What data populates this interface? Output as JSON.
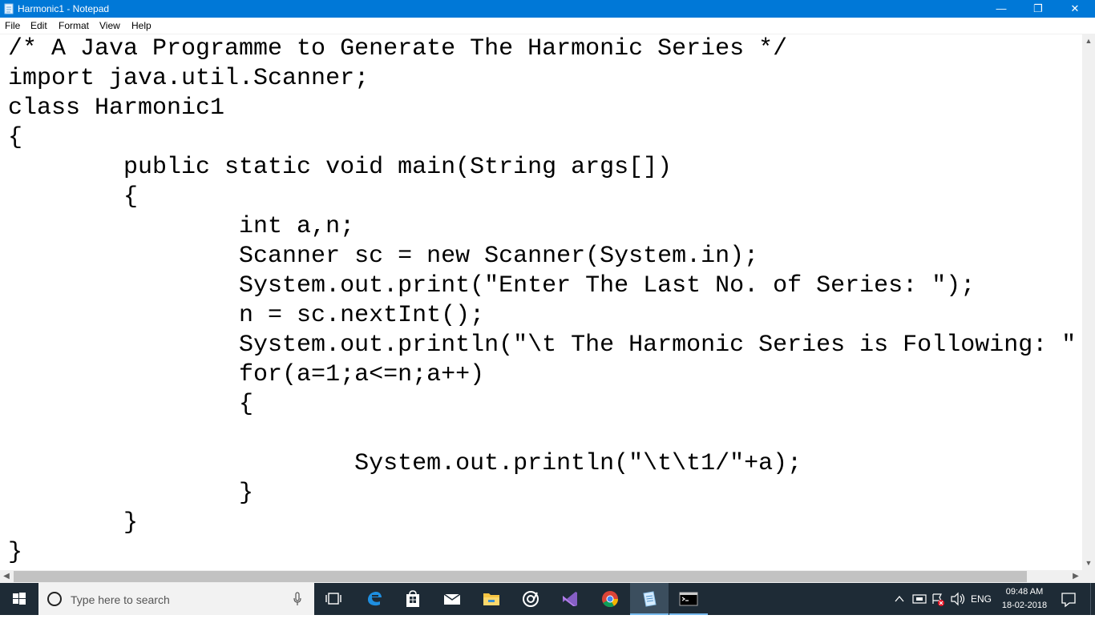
{
  "window": {
    "title": "Harmonic1 - Notepad",
    "controls": {
      "minimize": "—",
      "maximize": "❐",
      "close": "✕"
    }
  },
  "menu": {
    "items": [
      {
        "label": "File"
      },
      {
        "label": "Edit"
      },
      {
        "label": "Format"
      },
      {
        "label": "View"
      },
      {
        "label": "Help"
      }
    ]
  },
  "editor": {
    "lines": [
      "/* A Java Programme to Generate The Harmonic Series */",
      "import java.util.Scanner;",
      "class Harmonic1",
      "{",
      "        public static void main(String args[])",
      "        {",
      "                int a,n;",
      "                Scanner sc = new Scanner(System.in);",
      "                System.out.print(\"Enter The Last No. of Series: \");",
      "                n = sc.nextInt();",
      "                System.out.println(\"\\t The Harmonic Series is Following: \"",
      "                for(a=1;a<=n;a++)",
      "                {",
      "",
      "                        System.out.println(\"\\t\\t1/\"+a);",
      "                }",
      "        }",
      "}"
    ]
  },
  "taskbar": {
    "search_placeholder": "Type here to search",
    "pinned": [
      {
        "name": "task-view",
        "icon": "task-view-icon"
      },
      {
        "name": "edge",
        "icon": "edge-icon"
      },
      {
        "name": "store",
        "icon": "store-icon"
      },
      {
        "name": "mail",
        "icon": "mail-icon"
      },
      {
        "name": "file-explorer",
        "icon": "folder-icon"
      },
      {
        "name": "groove",
        "icon": "groove-icon"
      },
      {
        "name": "visual-studio",
        "icon": "visual-studio-icon"
      },
      {
        "name": "chrome",
        "icon": "chrome-icon"
      },
      {
        "name": "notepad",
        "icon": "notepad-icon",
        "active": true
      },
      {
        "name": "command-prompt",
        "icon": "cmd-icon",
        "running": true
      }
    ],
    "tray": {
      "language": "ENG",
      "time": "09:48 AM",
      "date": "18-02-2018"
    }
  },
  "colors": {
    "titlebar": "#0078d7",
    "taskbar": "#1e2b36",
    "accent": "#76b9ed"
  }
}
